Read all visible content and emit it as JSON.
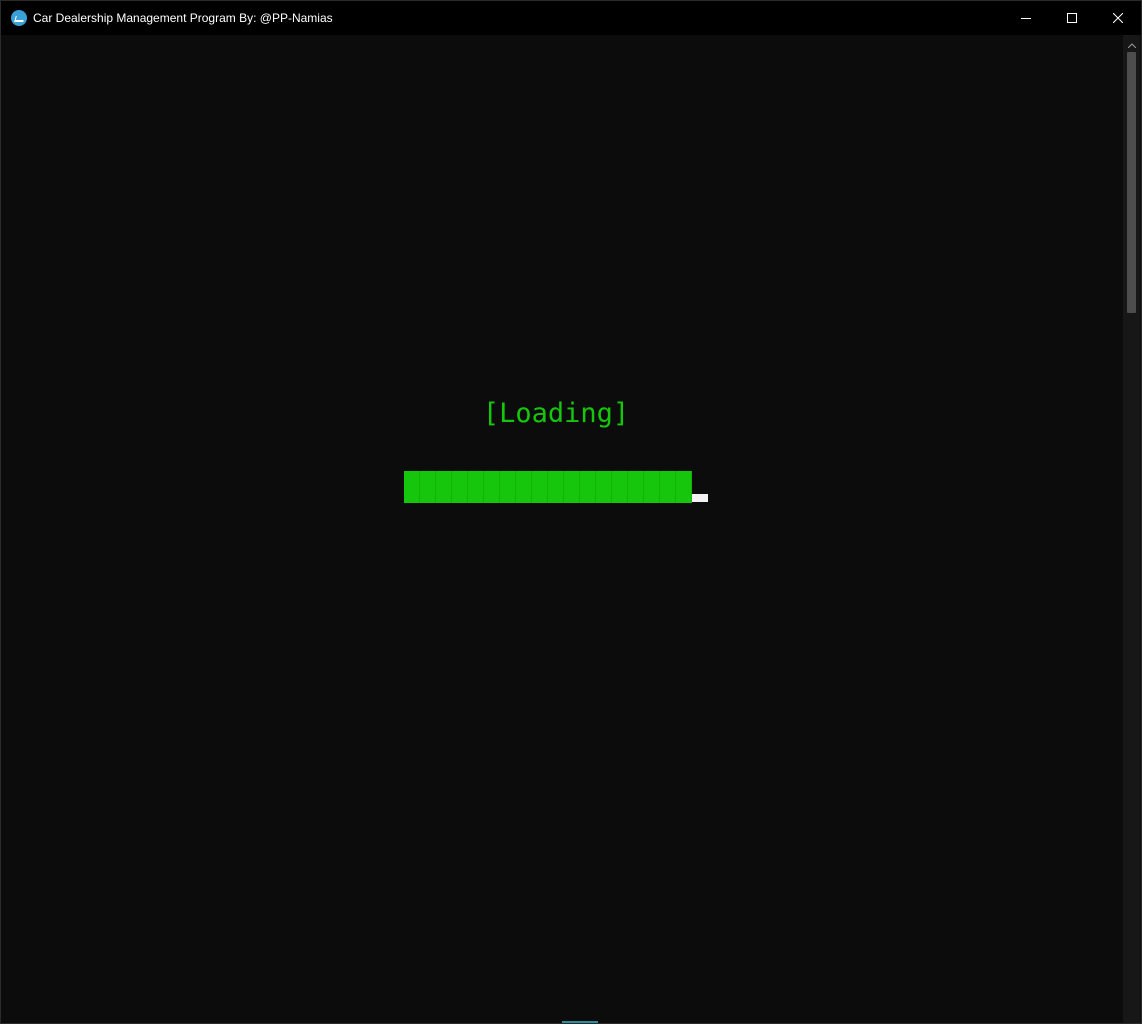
{
  "window": {
    "title": "Car Dealership Management Program By: @PP-Namias",
    "icon": "app-icon"
  },
  "controls": {
    "minimize_icon": "minimize-icon",
    "maximize_icon": "maximize-icon",
    "close_icon": "close-icon"
  },
  "console": {
    "loading_text": "[Loading]",
    "progress_segments_filled": 18,
    "text_color": "#16c60c",
    "background_color": "#0c0c0c"
  }
}
